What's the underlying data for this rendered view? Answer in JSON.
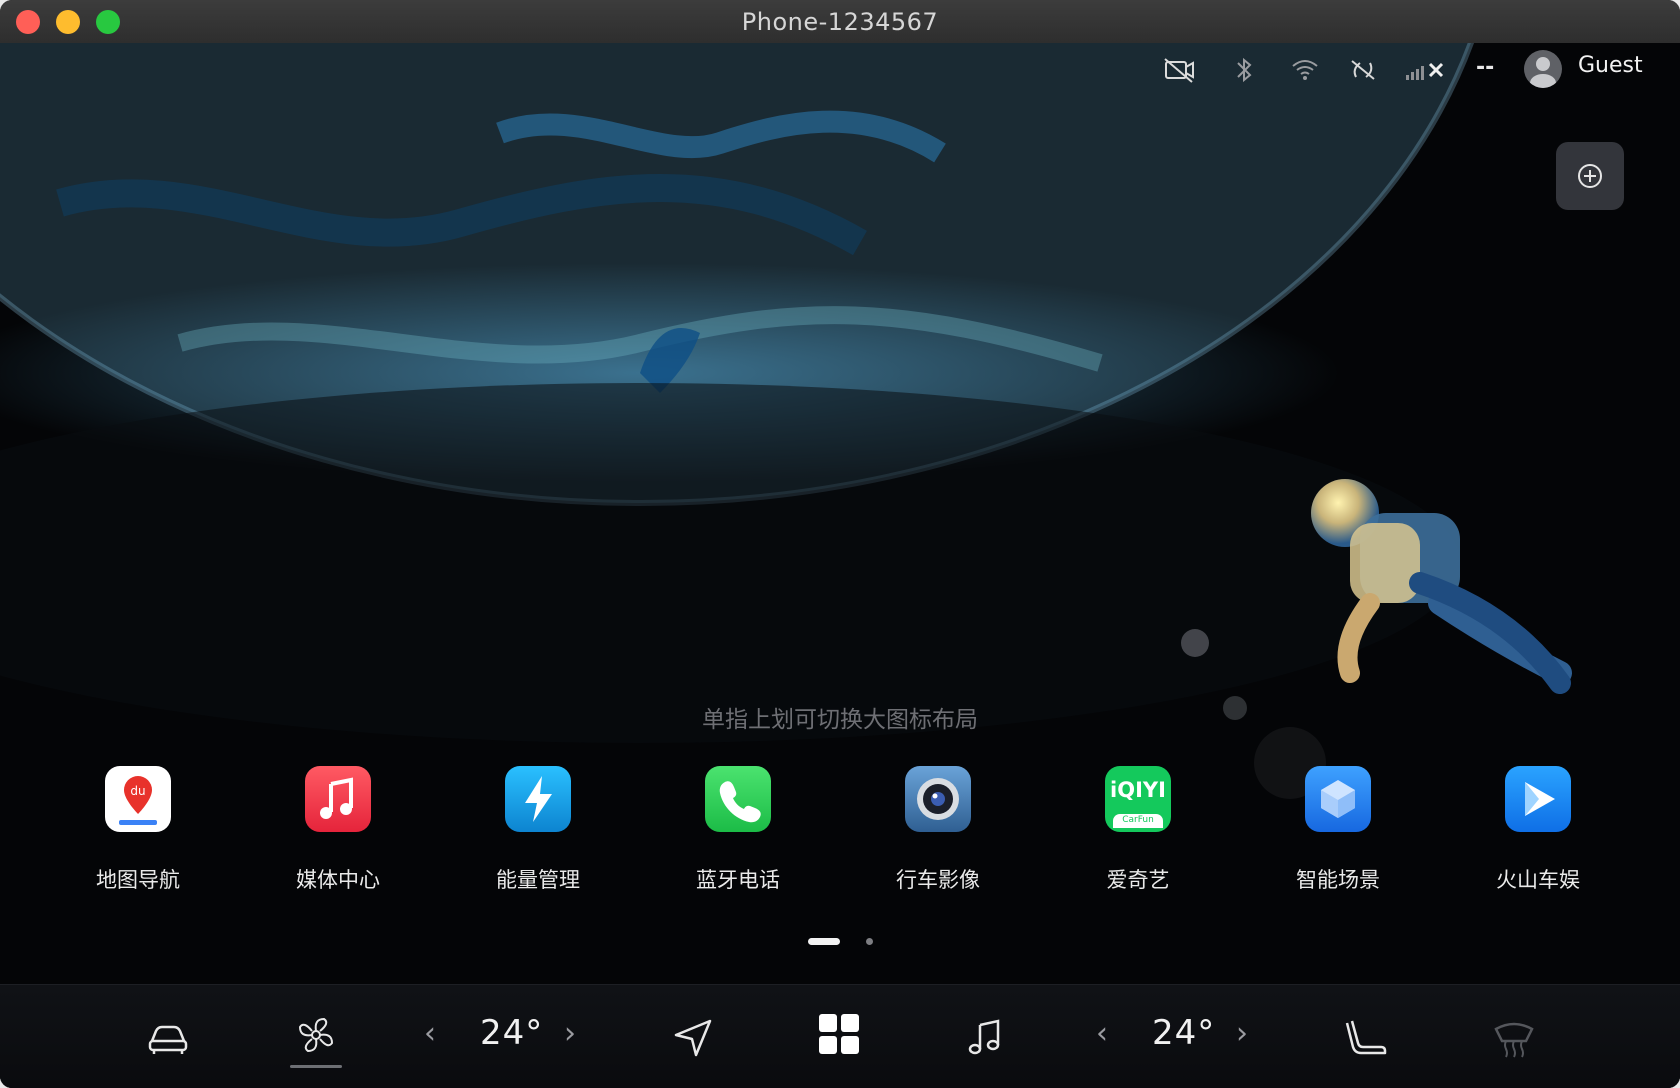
{
  "window": {
    "title": "Phone-1234567"
  },
  "status_bar": {
    "icons": [
      "camera-off-icon",
      "bluetooth-icon",
      "wifi-icon",
      "signal-off-icon",
      "cellular-no-signal-icon"
    ],
    "carrier_text": "--",
    "user_label": "Guest"
  },
  "home": {
    "hint": "单指上划可切换大图标布局",
    "apps": [
      {
        "label": "地图导航",
        "icon": "map-navigation-icon"
      },
      {
        "label": "媒体中心",
        "icon": "music-icon"
      },
      {
        "label": "能量管理",
        "icon": "energy-lightning-icon"
      },
      {
        "label": "蓝牙电话",
        "icon": "phone-icon"
      },
      {
        "label": "行车影像",
        "icon": "camera-lens-icon"
      },
      {
        "label": "爱奇艺",
        "icon": "iqiyi-icon",
        "logo_text": "iQIYI",
        "logo_sub": "CarFun"
      },
      {
        "label": "智能场景",
        "icon": "cube-icon"
      },
      {
        "label": "火山车娱",
        "icon": "play-icon"
      }
    ],
    "page_indicator": {
      "pages": 2,
      "current": 1
    }
  },
  "dock": {
    "left_temp": "24°",
    "right_temp": "24°",
    "prev_glyph": "‹",
    "next_glyph": "›",
    "icons": [
      "car-icon",
      "fan-icon",
      "navigation-icon",
      "apps-grid-icon",
      "music-note-icon",
      "seat-icon",
      "rear-defrost-icon"
    ]
  },
  "colors": {
    "map": "#ffffff",
    "media": "#f0364a",
    "energy": "#1aa7e8",
    "phone": "#2fd158",
    "camera": "#4a7fb8",
    "iqiyi": "#11c75a",
    "scene": "#2d8cf0",
    "volcano": "#1a8cff"
  }
}
